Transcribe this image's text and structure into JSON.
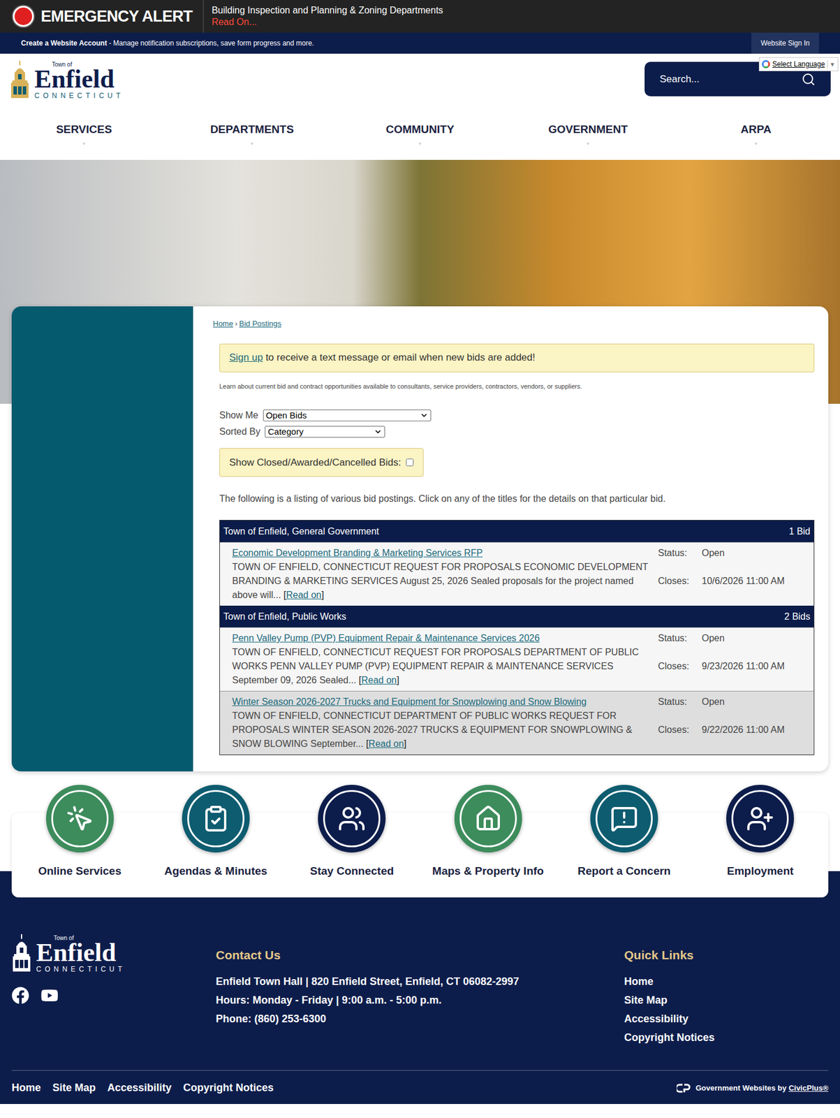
{
  "alert": {
    "title": "EMERGENCY ALERT",
    "message": "Building Inspection and Planning & Zoning Departments",
    "link": "Read On..."
  },
  "account_bar": {
    "link": "Create a Website Account",
    "text": " - Manage notification subscriptions, save form progress and more.",
    "button": "Website Sign In"
  },
  "language": {
    "label": "Select Language",
    "arrow": "▼"
  },
  "logo": {
    "small": "Town of",
    "name": "Enfield",
    "state": "CONNECTICUT"
  },
  "search": {
    "placeholder": "Search..."
  },
  "nav": [
    "SERVICES",
    "DEPARTMENTS",
    "COMMUNITY",
    "GOVERNMENT",
    "ARPA"
  ],
  "breadcrumb": {
    "items": [
      "Home",
      "Bid Postings"
    ],
    "separator": "›"
  },
  "signup": {
    "link": "Sign up",
    "text": " to receive a text message or email when new bids are added!"
  },
  "intro": "Learn about current bid and contract opportunities available to consultants, service providers, contractors, vendors, or suppliers.",
  "filters": [
    {
      "label": "Show Me",
      "value": "Open Bids"
    },
    {
      "label": "Sorted By",
      "value": "Category"
    }
  ],
  "show_closed": {
    "label": "Show Closed/Awarded/Cancelled Bids:",
    "checked": false
  },
  "listing_note": "The following is a listing of various bid postings. Click on any of the titles for the details on that particular bid.",
  "brackets": [
    "[",
    "]"
  ],
  "categories": [
    {
      "name": "Town of Enfield, General Government",
      "count": "1 Bid",
      "bids": [
        {
          "title": "Economic Development Branding & Marketing Services RFP",
          "excerpt": "TOWN OF ENFIELD, CONNECTICUT REQUEST FOR PROPOSALS ECONOMIC DEVELOPMENT BRANDING & MARKETING SERVICES August 25, 2026 Sealed proposals for the project named above will...",
          "read_more": "Read on",
          "status_label": "Status:",
          "status": "Open",
          "closes_label": "Closes:",
          "closes": "10/6/2026 11:00 AM",
          "highlighted": false
        }
      ]
    },
    {
      "name": "Town of Enfield, Public Works",
      "count": "2 Bids",
      "bids": [
        {
          "title": "Penn Valley Pump (PVP) Equipment Repair & Maintenance Services 2026",
          "excerpt": "TOWN OF ENFIELD, CONNECTICUT REQUEST FOR PROPOSALS DEPARTMENT OF PUBLIC WORKS PENN VALLEY PUMP (PVP) EQUIPMENT REPAIR & MAINTENANCE SERVICES September 09, 2026 Sealed...",
          "read_more": "Read on",
          "status_label": "Status:",
          "status": "Open",
          "closes_label": "Closes:",
          "closes": "9/23/2026 11:00 AM",
          "highlighted": false
        },
        {
          "title": "Winter Season 2026-2027 Trucks and Equipment for Snowplowing and Snow Blowing",
          "excerpt": "TOWN OF ENFIELD, CONNECTICUT DEPARTMENT OF PUBLIC WORKS REQUEST FOR PROPOSALS WINTER SEASON 2026-2027 TRUCKS & EQUIPMENT FOR SNOWPLOWING & SNOW BLOWING September...",
          "read_more": "Read on",
          "status_label": "Status:",
          "status": "Open",
          "closes_label": "Closes:",
          "closes": "9/22/2026 11:00 AM",
          "highlighted": true
        }
      ]
    }
  ],
  "quick_links": [
    {
      "label": "Online Services",
      "color": "#3d8c5c"
    },
    {
      "label": "Agendas & Minutes",
      "color": "#0e5c70"
    },
    {
      "label": "Stay Connected",
      "color": "#0d1d4b"
    },
    {
      "label": "Maps & Property Info",
      "color": "#3d8c5c"
    },
    {
      "label": "Report a Concern",
      "color": "#0e5c70"
    },
    {
      "label": "Employment",
      "color": "#0d1d4b"
    }
  ],
  "footer": {
    "contact_title": "Contact Us",
    "contact_lines": [
      "Enfield Town Hall | 820 Enfield Street, Enfield, CT 06082-2997",
      "Hours: Monday - Friday | 9:00 a.m. - 5:00 p.m.",
      "Phone: (860) 253-6300"
    ],
    "quick_title": "Quick Links",
    "quick_items": [
      "Home",
      "Site Map",
      "Accessibility",
      "Copyright Notices"
    ],
    "bottom_links": [
      "Home",
      "Site Map",
      "Accessibility",
      "Copyright Notices"
    ],
    "credit_text": "Government Websites by ",
    "credit_link": "CivicPlus®"
  }
}
